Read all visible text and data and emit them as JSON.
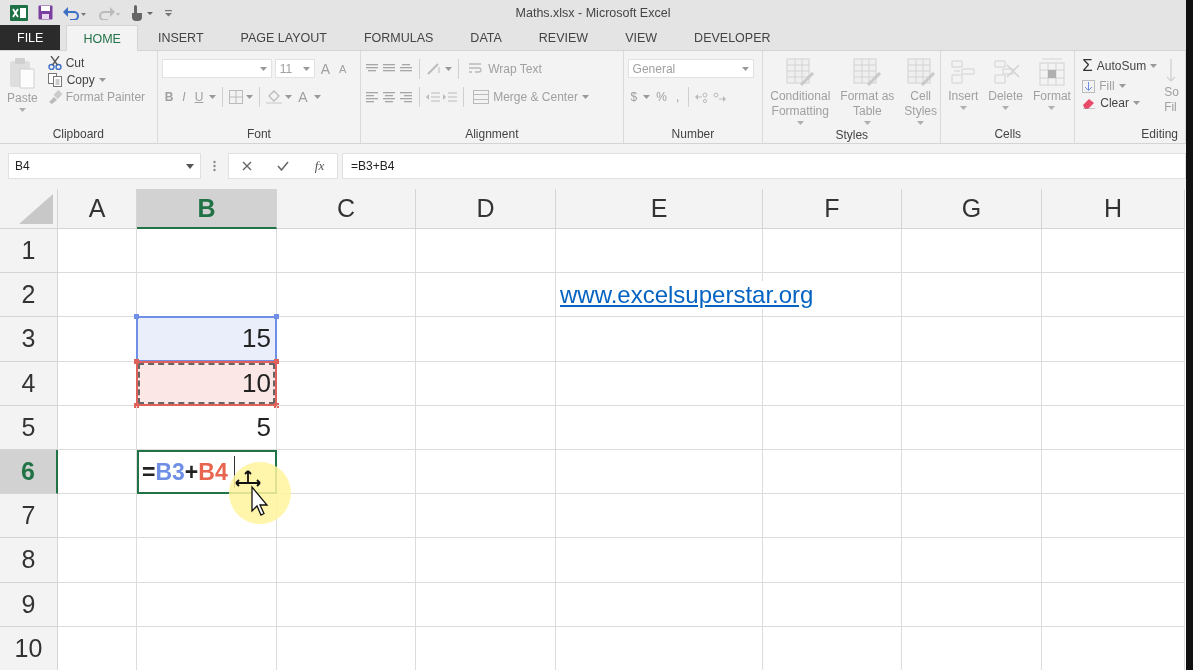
{
  "window": {
    "title": "Maths.xlsx - Microsoft Excel"
  },
  "tabs": [
    {
      "label": "FILE",
      "kind": "file",
      "selected": false
    },
    {
      "label": "HOME",
      "kind": "tab",
      "selected": true
    },
    {
      "label": "INSERT",
      "kind": "tab",
      "selected": false
    },
    {
      "label": "PAGE LAYOUT",
      "kind": "tab",
      "selected": false
    },
    {
      "label": "FORMULAS",
      "kind": "tab",
      "selected": false
    },
    {
      "label": "DATA",
      "kind": "tab",
      "selected": false
    },
    {
      "label": "REVIEW",
      "kind": "tab",
      "selected": false
    },
    {
      "label": "VIEW",
      "kind": "tab",
      "selected": false
    },
    {
      "label": "DEVELOPER",
      "kind": "tab",
      "selected": false
    }
  ],
  "ribbon": {
    "clipboard": {
      "title": "Clipboard",
      "paste": {
        "label": "Paste",
        "disabled": true
      },
      "cut": {
        "label": "Cut",
        "disabled": false
      },
      "copy": {
        "label": "Copy",
        "disabled": false
      },
      "format_painter": {
        "label": "Format Painter",
        "disabled": true
      }
    },
    "font": {
      "title": "Font",
      "font_size": {
        "value": "11"
      },
      "size_buttons": [
        "A",
        "A"
      ],
      "style_buttons": [
        "B",
        "I",
        "U"
      ],
      "font_color_button": "A"
    },
    "alignment": {
      "title": "Alignment",
      "wrap_text": "Wrap Text",
      "merge_center": "Merge & Center"
    },
    "number": {
      "title": "Number",
      "format": {
        "value": "General"
      },
      "buttons": [
        "$",
        "%",
        ","
      ]
    },
    "styles": {
      "title": "Styles",
      "buttons": [
        {
          "lines": [
            "Conditional",
            "Formatting"
          ]
        },
        {
          "lines": [
            "Format as",
            "Table"
          ]
        },
        {
          "lines": [
            "Cell",
            "Styles"
          ]
        }
      ]
    },
    "cells": {
      "title": "Cells",
      "buttons": [
        {
          "lines": [
            "Insert"
          ]
        },
        {
          "lines": [
            "Delete"
          ]
        },
        {
          "lines": [
            "Format"
          ]
        }
      ]
    },
    "editing": {
      "title": "Editing",
      "autosum": {
        "symbol": "Σ",
        "label": "AutoSum",
        "disabled": false
      },
      "fill": {
        "label": "Fill",
        "disabled": true
      },
      "clear": {
        "label": "Clear",
        "disabled": false
      },
      "sort_filter": {
        "lines": [
          "So",
          "Fil"
        ]
      }
    }
  },
  "formula_bar": {
    "name_box": "B4",
    "function_button": "fx",
    "formula": "=B3+B4"
  },
  "sheet": {
    "columns": [
      {
        "label": "A",
        "selected": false
      },
      {
        "label": "B",
        "selected": true
      },
      {
        "label": "C",
        "selected": false
      },
      {
        "label": "D",
        "selected": false
      },
      {
        "label": "E",
        "selected": false
      },
      {
        "label": "F",
        "selected": false
      },
      {
        "label": "G",
        "selected": false
      },
      {
        "label": "H",
        "selected": false
      }
    ],
    "rows": [
      {
        "label": "1",
        "selected": false
      },
      {
        "label": "2",
        "selected": false,
        "cells": {
          "E": {
            "kind": "link",
            "value": "www.excelsuperstar.org"
          }
        }
      },
      {
        "label": "3",
        "selected": false,
        "cells": {
          "B": {
            "kind": "number",
            "value": "15",
            "color": "#6f8fe6"
          }
        }
      },
      {
        "label": "4",
        "selected": false,
        "cells": {
          "B": {
            "kind": "number",
            "value": "10",
            "color": "#e0605a",
            "marquee": true
          }
        }
      },
      {
        "label": "5",
        "selected": false,
        "cells": {
          "B": {
            "kind": "number",
            "value": "5"
          }
        }
      },
      {
        "label": "6",
        "selected": true,
        "cells": {
          "B": {
            "kind": "formula",
            "editing": true,
            "parts": [
              {
                "text": "=",
                "color": "#222222"
              },
              {
                "text": "B3",
                "color": "#6f8fe6"
              },
              {
                "text": "+",
                "color": "#222222"
              },
              {
                "text": "B4",
                "color": "#e8654f"
              }
            ]
          }
        }
      },
      {
        "label": "7",
        "selected": false
      },
      {
        "label": "8",
        "selected": false
      },
      {
        "label": "9",
        "selected": false
      },
      {
        "label": "10",
        "selected": false
      }
    ]
  }
}
